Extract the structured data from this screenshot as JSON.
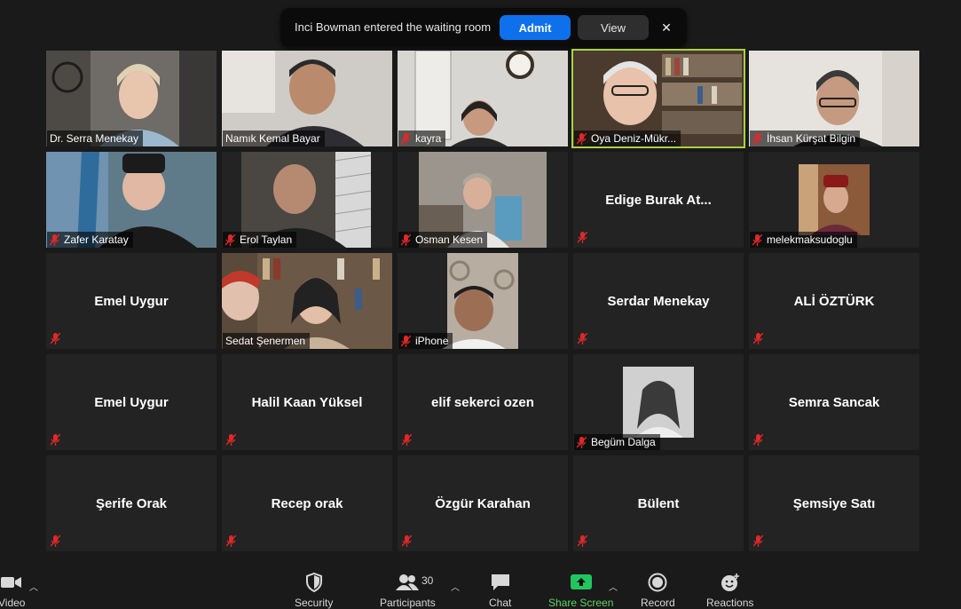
{
  "notification": {
    "message": "Inci Bowman entered the waiting room",
    "admit_label": "Admit",
    "view_label": "View",
    "close_glyph": "✕"
  },
  "participants": [
    {
      "name": "Dr. Serra Menekay",
      "video": true,
      "muted": false
    },
    {
      "name": "Namık Kemal Bayar",
      "video": true,
      "muted": false
    },
    {
      "name": "kayra",
      "video": true,
      "muted": true
    },
    {
      "name": "Oya Deniz-Mükr...",
      "video": true,
      "muted": true,
      "speaking": true
    },
    {
      "name": "İhsan Kürşat Bilgin",
      "video": true,
      "muted": true
    },
    {
      "name": "Zafer Karatay",
      "video": true,
      "muted": true
    },
    {
      "name": "Erol Taylan",
      "video": true,
      "muted": true
    },
    {
      "name": "Osman Kesen",
      "video": true,
      "muted": true
    },
    {
      "name": "Edige Burak At...",
      "video": false,
      "muted": true
    },
    {
      "name": "melekmaksudoglu",
      "video": true,
      "muted": true
    },
    {
      "name": "Emel Uygur",
      "video": false,
      "muted": true
    },
    {
      "name": "Sedat Şenermen",
      "video": true,
      "muted": false
    },
    {
      "name": "iPhone",
      "video": true,
      "muted": true
    },
    {
      "name": "Serdar Menekay",
      "video": false,
      "muted": true
    },
    {
      "name": "ALİ ÖZTÜRK",
      "video": false,
      "muted": true
    },
    {
      "name": "Emel Uygur",
      "video": false,
      "muted": true
    },
    {
      "name": "Halil Kaan Yüksel",
      "video": false,
      "muted": true
    },
    {
      "name": "elif sekerci ozen",
      "video": false,
      "muted": true
    },
    {
      "name": "Begüm Dalga",
      "video": true,
      "muted": true
    },
    {
      "name": "Semra Sancak",
      "video": false,
      "muted": true
    },
    {
      "name": "Şerife Orak",
      "video": false,
      "muted": true
    },
    {
      "name": "Recep orak",
      "video": false,
      "muted": true
    },
    {
      "name": "Özgür Karahan",
      "video": false,
      "muted": true
    },
    {
      "name": "Bülent",
      "video": false,
      "muted": true
    },
    {
      "name": "Şemsiye Satı",
      "video": false,
      "muted": true
    }
  ],
  "toolbar": {
    "video_label": "Video",
    "security_label": "Security",
    "participants_label": "Participants",
    "participants_count": "30",
    "chat_label": "Chat",
    "share_label": "Share Screen",
    "record_label": "Record",
    "reactions_label": "Reactions"
  },
  "colors": {
    "accent_blue": "#0e71eb",
    "share_green": "#22c55e",
    "speaking_border": "#a7d344",
    "muted_red": "#e02828",
    "share_label": "#5fd35f"
  }
}
